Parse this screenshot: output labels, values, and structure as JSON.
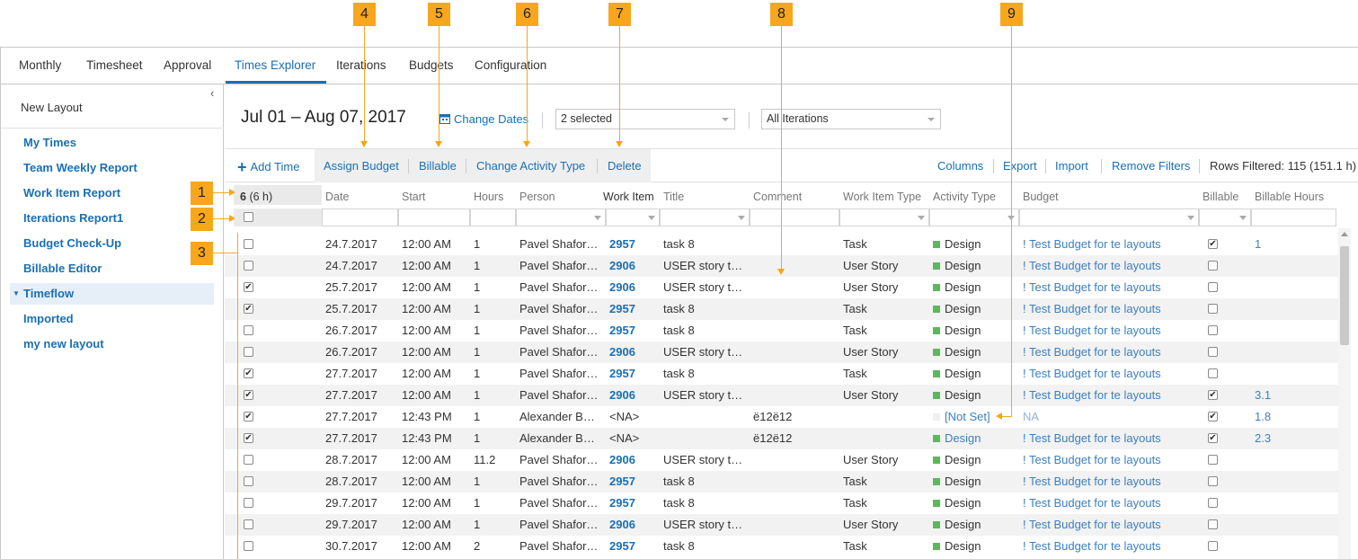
{
  "nav": {
    "tabs": [
      "Monthly",
      "Timesheet",
      "Approval",
      "Times Explorer",
      "Iterations",
      "Budgets",
      "Configuration"
    ],
    "active": "Times Explorer"
  },
  "sidebar": {
    "collapse_glyph": "‹",
    "new_layout": "New Layout",
    "items": [
      "My Times",
      "Team Weekly Report",
      "Work Item Report",
      "Iterations Report1",
      "Budget Check-Up",
      "Billable Editor",
      "Timeflow",
      "Imported",
      "my new layout"
    ],
    "selected": "Timeflow"
  },
  "header": {
    "date_range": "Jul 01 – Aug 07, 2017",
    "change_dates": "Change Dates",
    "people_filter": "2 selected",
    "iterations_filter": "All Iterations"
  },
  "toolbar": {
    "add_time": "Add Time",
    "assign_budget": "Assign Budget",
    "billable": "Billable",
    "change_activity_type": "Change Activity Type",
    "delete": "Delete",
    "columns": "Columns",
    "export": "Export",
    "import": "Import",
    "remove_filters": "Remove Filters",
    "rows_filtered": "Rows Filtered: 115 (151.1 h)"
  },
  "grid": {
    "selection_summary_count": "6",
    "selection_summary_hours": "(6 h)",
    "columns": [
      "Date",
      "Start",
      "Hours",
      "Person",
      "Work Item",
      "Title",
      "Comment",
      "Work Item Type",
      "Activity Type",
      "Budget",
      "Billable",
      "Billable Hours"
    ],
    "rows": [
      {
        "checked": false,
        "date": "24.7.2017",
        "start": "12:00 AM",
        "hours": "1",
        "person": "Pavel Shafor…",
        "work_item": "2957",
        "title": "task 8",
        "comment": "",
        "type": "Task",
        "activity": "Design",
        "activity_link": false,
        "budget": "! Test Budget for te layouts",
        "billable": true,
        "billable_hours": "1"
      },
      {
        "checked": false,
        "date": "24.7.2017",
        "start": "12:00 AM",
        "hours": "1",
        "person": "Pavel Shafor…",
        "work_item": "2906",
        "title": "USER story t…",
        "comment": "",
        "type": "User Story",
        "activity": "Design",
        "activity_link": false,
        "budget": "! Test Budget for te layouts",
        "billable": false,
        "billable_hours": ""
      },
      {
        "checked": true,
        "date": "25.7.2017",
        "start": "12:00 AM",
        "hours": "1",
        "person": "Pavel Shafor…",
        "work_item": "2906",
        "title": "USER story t…",
        "comment": "",
        "type": "User Story",
        "activity": "Design",
        "activity_link": false,
        "budget": "! Test Budget for te layouts",
        "billable": false,
        "billable_hours": ""
      },
      {
        "checked": true,
        "date": "25.7.2017",
        "start": "12:00 AM",
        "hours": "1",
        "person": "Pavel Shafor…",
        "work_item": "2957",
        "title": "task 8",
        "comment": "",
        "type": "Task",
        "activity": "Design",
        "activity_link": false,
        "budget": "! Test Budget for te layouts",
        "billable": false,
        "billable_hours": ""
      },
      {
        "checked": false,
        "date": "26.7.2017",
        "start": "12:00 AM",
        "hours": "1",
        "person": "Pavel Shafor…",
        "work_item": "2957",
        "title": "task 8",
        "comment": "",
        "type": "Task",
        "activity": "Design",
        "activity_link": false,
        "budget": "! Test Budget for te layouts",
        "billable": false,
        "billable_hours": ""
      },
      {
        "checked": false,
        "date": "26.7.2017",
        "start": "12:00 AM",
        "hours": "1",
        "person": "Pavel Shafor…",
        "work_item": "2906",
        "title": "USER story t…",
        "comment": "",
        "type": "User Story",
        "activity": "Design",
        "activity_link": false,
        "budget": "! Test Budget for te layouts",
        "billable": false,
        "billable_hours": ""
      },
      {
        "checked": true,
        "date": "27.7.2017",
        "start": "12:00 AM",
        "hours": "1",
        "person": "Pavel Shafor…",
        "work_item": "2957",
        "title": "task 8",
        "comment": "",
        "type": "Task",
        "activity": "Design",
        "activity_link": false,
        "budget": "! Test Budget for te layouts",
        "billable": false,
        "billable_hours": ""
      },
      {
        "checked": true,
        "date": "27.7.2017",
        "start": "12:00 AM",
        "hours": "1",
        "person": "Pavel Shafor…",
        "work_item": "2906",
        "title": "USER story t…",
        "comment": "",
        "type": "User Story",
        "activity": "Design",
        "activity_link": false,
        "budget": "! Test Budget for te layouts",
        "billable": true,
        "billable_hours": "3.1"
      },
      {
        "checked": true,
        "date": "27.7.2017",
        "start": "12:43 PM",
        "hours": "1",
        "person": "Alexander B…",
        "work_item": "<NA>",
        "title": "",
        "comment": "ё12ё12",
        "type": "",
        "activity": "[Not Set]",
        "activity_link": true,
        "budget": "NA",
        "billable": true,
        "billable_hours": "1.8"
      },
      {
        "checked": true,
        "date": "27.7.2017",
        "start": "12:43 PM",
        "hours": "1",
        "person": "Alexander B…",
        "work_item": "<NA>",
        "title": "",
        "comment": "ё12ё12",
        "type": "",
        "activity": "Design",
        "activity_link": true,
        "budget": "! Test Budget for te layouts",
        "billable": true,
        "billable_hours": "2.3"
      },
      {
        "checked": false,
        "date": "28.7.2017",
        "start": "12:00 AM",
        "hours": "11.2",
        "person": "Pavel Shafor…",
        "work_item": "2906",
        "title": "USER story t…",
        "comment": "",
        "type": "User Story",
        "activity": "Design",
        "activity_link": false,
        "budget": "! Test Budget for te layouts",
        "billable": false,
        "billable_hours": ""
      },
      {
        "checked": false,
        "date": "28.7.2017",
        "start": "12:00 AM",
        "hours": "1",
        "person": "Pavel Shafor…",
        "work_item": "2957",
        "title": "task 8",
        "comment": "",
        "type": "Task",
        "activity": "Design",
        "activity_link": false,
        "budget": "! Test Budget for te layouts",
        "billable": false,
        "billable_hours": ""
      },
      {
        "checked": false,
        "date": "29.7.2017",
        "start": "12:00 AM",
        "hours": "1",
        "person": "Pavel Shafor…",
        "work_item": "2957",
        "title": "task 8",
        "comment": "",
        "type": "Task",
        "activity": "Design",
        "activity_link": false,
        "budget": "! Test Budget for te layouts",
        "billable": false,
        "billable_hours": ""
      },
      {
        "checked": false,
        "date": "29.7.2017",
        "start": "12:00 AM",
        "hours": "1",
        "person": "Pavel Shafor…",
        "work_item": "2906",
        "title": "USER story t…",
        "comment": "",
        "type": "User Story",
        "activity": "Design",
        "activity_link": false,
        "budget": "! Test Budget for te layouts",
        "billable": false,
        "billable_hours": ""
      },
      {
        "checked": false,
        "date": "30.7.2017",
        "start": "12:00 AM",
        "hours": "2",
        "person": "Pavel Shafor…",
        "work_item": "2957",
        "title": "task 8",
        "comment": "",
        "type": "Task",
        "activity": "Design",
        "activity_link": false,
        "budget": "! Test Budget for te layouts",
        "billable": false,
        "billable_hours": ""
      }
    ]
  },
  "callouts": [
    "1",
    "2",
    "3",
    "4",
    "5",
    "6",
    "7",
    "8",
    "9"
  ],
  "colors": {
    "accent": "#1a6fb4",
    "design_swatch": "#5cb85c",
    "not_set_swatch": "#f0f0f0",
    "callout": "#f8a61c"
  }
}
